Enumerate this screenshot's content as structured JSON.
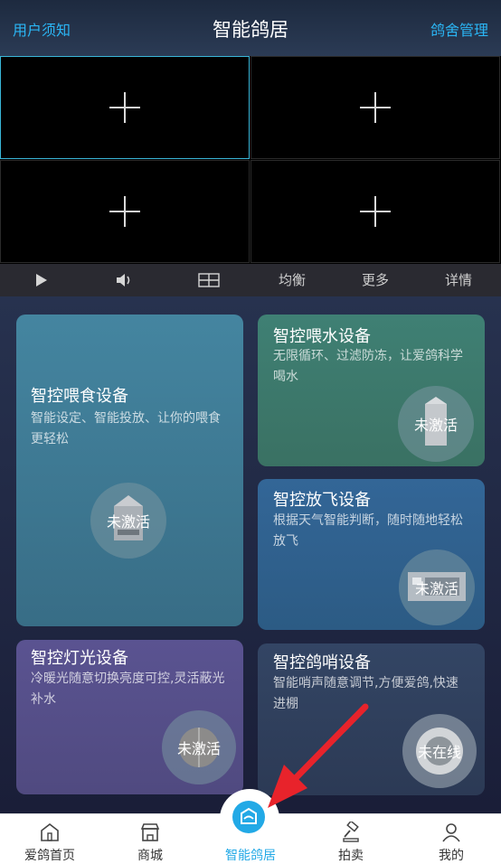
{
  "header": {
    "left_link": "用户须知",
    "title": "智能鸽居",
    "right_link": "鸽舍管理"
  },
  "video": {
    "cells": [
      "add-camera",
      "add-camera",
      "add-camera",
      "add-camera"
    ]
  },
  "controls": {
    "play_icon": "play-icon",
    "volume_icon": "volume-icon",
    "layout_icon": "grid-layout-icon",
    "balance": "均衡",
    "more": "更多",
    "details": "详情"
  },
  "cards": {
    "feeding": {
      "title": "智控喂食设备",
      "desc": "智能设定、智能投放、让你的喂食更轻松",
      "status": "未激活"
    },
    "water": {
      "title": "智控喂水设备",
      "desc": "无限循环、过滤防冻，让爱鸽科学喝水",
      "status": "未激活"
    },
    "flight": {
      "title": "智控放飞设备",
      "desc": "根据天气智能判断，随时随地轻松放飞",
      "status": "未激活"
    },
    "light": {
      "title": "智控灯光设备",
      "desc": "冷暖光随意切换亮度可控,灵活蔽光补水",
      "status": "未激活"
    },
    "whistle": {
      "title": "智控鸽哨设备",
      "desc": "智能哨声随意调节,方便爱鸽,快速进棚",
      "status": "未在线"
    }
  },
  "tabbar": {
    "items": [
      {
        "label": "爱鸽首页",
        "icon": "home-icon"
      },
      {
        "label": "商城",
        "icon": "store-icon"
      },
      {
        "label": "智能鸽居",
        "icon": "smart-home-icon"
      },
      {
        "label": "拍卖",
        "icon": "auction-icon"
      },
      {
        "label": "我的",
        "icon": "user-icon"
      }
    ],
    "active_index": 2
  },
  "colors": {
    "accent": "#22a9e6",
    "feeding_card": "#3e7f97",
    "water_card": "#3c7b6c",
    "flight_card": "#2f5c86",
    "light_card": "#574f87",
    "whistle_card": "#31405f",
    "annotation_arrow": "#e8232b"
  }
}
